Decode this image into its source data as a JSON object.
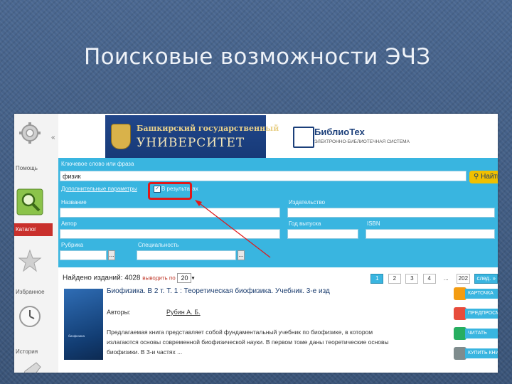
{
  "slide": {
    "title": "Поисковые возможности ЭЧЗ"
  },
  "sidebar": {
    "items": [
      {
        "label": "Помощь",
        "icon": "gear-icon"
      },
      {
        "label": "Каталог",
        "icon": "magnifier-catalog-icon",
        "active": true
      },
      {
        "label": "Избранное",
        "icon": "star-icon"
      },
      {
        "label": "История",
        "icon": "clock-icon"
      }
    ],
    "collapse": "«"
  },
  "banner": {
    "university_line1": "Башкирский государственный",
    "university_line2": "УНИВЕРСИТЕТ",
    "biblio_name": "БиблиоТех",
    "biblio_sub": "ЭЛЕКТРОННО-БИБЛИОТЕЧНАЯ СИСТЕМА"
  },
  "search": {
    "query_label": "Ключевое слово или фраза",
    "query_value": "физик",
    "find_button": "Найти",
    "advanced_link": "Дополнительные параметры",
    "checkbox_label": "В результатах",
    "checkbox_checked": true,
    "title_label": "Название",
    "publisher_label": "Издательство",
    "author_label": "Автор",
    "year_label": "Год выпуска",
    "isbn_label": "ISBN",
    "rubric_label": "Рубрика",
    "specialty_label": "Специальность",
    "select_glyph": "..."
  },
  "results": {
    "found_text": "Найдено изданий: 4028",
    "per_page_label": "выводить по",
    "per_page_value": "20",
    "pages": [
      "1",
      "2",
      "3",
      "4",
      "..."
    ],
    "last_page": "202",
    "next_label": "след. »",
    "item": {
      "title": "Биофизика. В 2 т. Т. 1 : Теоретическая биофизика. Учебник. 3-е изд",
      "author_label": "Авторы:",
      "author_value": "Рубин А. Б.",
      "description": "Предлагаемая книга представляет собой фундаментальный учебник по биофизике, в котором излагаются основы современной биофизической науки. В первом томе даны теоретические основы биофизики. В 3-и частях ...",
      "cover_text": "биофизика"
    },
    "actions": [
      {
        "label": "КАРТОЧКА",
        "icon": "info-icon",
        "color": "#f39c12"
      },
      {
        "label": "ПРЕДПРОСМ",
        "icon": "preview-icon",
        "color": "#e74c3c"
      },
      {
        "label": "ЧИТАТЬ",
        "icon": "book-icon",
        "color": "#27ae60"
      },
      {
        "label": "КУПИТЬ КНИ",
        "icon": "cart-icon",
        "color": "#7f8c8d"
      }
    ]
  },
  "colors": {
    "accent": "#39b5e0",
    "highlight": "#e01818",
    "background": "#3e5a7e"
  }
}
